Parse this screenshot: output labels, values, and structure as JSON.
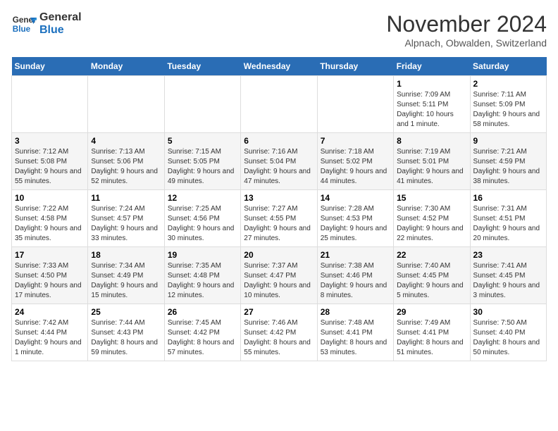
{
  "logo": {
    "line1": "General",
    "line2": "Blue"
  },
  "title": "November 2024",
  "location": "Alpnach, Obwalden, Switzerland",
  "days_header": [
    "Sunday",
    "Monday",
    "Tuesday",
    "Wednesday",
    "Thursday",
    "Friday",
    "Saturday"
  ],
  "weeks": [
    [
      {
        "num": "",
        "info": ""
      },
      {
        "num": "",
        "info": ""
      },
      {
        "num": "",
        "info": ""
      },
      {
        "num": "",
        "info": ""
      },
      {
        "num": "",
        "info": ""
      },
      {
        "num": "1",
        "info": "Sunrise: 7:09 AM\nSunset: 5:11 PM\nDaylight: 10 hours and 1 minute."
      },
      {
        "num": "2",
        "info": "Sunrise: 7:11 AM\nSunset: 5:09 PM\nDaylight: 9 hours and 58 minutes."
      }
    ],
    [
      {
        "num": "3",
        "info": "Sunrise: 7:12 AM\nSunset: 5:08 PM\nDaylight: 9 hours and 55 minutes."
      },
      {
        "num": "4",
        "info": "Sunrise: 7:13 AM\nSunset: 5:06 PM\nDaylight: 9 hours and 52 minutes."
      },
      {
        "num": "5",
        "info": "Sunrise: 7:15 AM\nSunset: 5:05 PM\nDaylight: 9 hours and 49 minutes."
      },
      {
        "num": "6",
        "info": "Sunrise: 7:16 AM\nSunset: 5:04 PM\nDaylight: 9 hours and 47 minutes."
      },
      {
        "num": "7",
        "info": "Sunrise: 7:18 AM\nSunset: 5:02 PM\nDaylight: 9 hours and 44 minutes."
      },
      {
        "num": "8",
        "info": "Sunrise: 7:19 AM\nSunset: 5:01 PM\nDaylight: 9 hours and 41 minutes."
      },
      {
        "num": "9",
        "info": "Sunrise: 7:21 AM\nSunset: 4:59 PM\nDaylight: 9 hours and 38 minutes."
      }
    ],
    [
      {
        "num": "10",
        "info": "Sunrise: 7:22 AM\nSunset: 4:58 PM\nDaylight: 9 hours and 35 minutes."
      },
      {
        "num": "11",
        "info": "Sunrise: 7:24 AM\nSunset: 4:57 PM\nDaylight: 9 hours and 33 minutes."
      },
      {
        "num": "12",
        "info": "Sunrise: 7:25 AM\nSunset: 4:56 PM\nDaylight: 9 hours and 30 minutes."
      },
      {
        "num": "13",
        "info": "Sunrise: 7:27 AM\nSunset: 4:55 PM\nDaylight: 9 hours and 27 minutes."
      },
      {
        "num": "14",
        "info": "Sunrise: 7:28 AM\nSunset: 4:53 PM\nDaylight: 9 hours and 25 minutes."
      },
      {
        "num": "15",
        "info": "Sunrise: 7:30 AM\nSunset: 4:52 PM\nDaylight: 9 hours and 22 minutes."
      },
      {
        "num": "16",
        "info": "Sunrise: 7:31 AM\nSunset: 4:51 PM\nDaylight: 9 hours and 20 minutes."
      }
    ],
    [
      {
        "num": "17",
        "info": "Sunrise: 7:33 AM\nSunset: 4:50 PM\nDaylight: 9 hours and 17 minutes."
      },
      {
        "num": "18",
        "info": "Sunrise: 7:34 AM\nSunset: 4:49 PM\nDaylight: 9 hours and 15 minutes."
      },
      {
        "num": "19",
        "info": "Sunrise: 7:35 AM\nSunset: 4:48 PM\nDaylight: 9 hours and 12 minutes."
      },
      {
        "num": "20",
        "info": "Sunrise: 7:37 AM\nSunset: 4:47 PM\nDaylight: 9 hours and 10 minutes."
      },
      {
        "num": "21",
        "info": "Sunrise: 7:38 AM\nSunset: 4:46 PM\nDaylight: 9 hours and 8 minutes."
      },
      {
        "num": "22",
        "info": "Sunrise: 7:40 AM\nSunset: 4:45 PM\nDaylight: 9 hours and 5 minutes."
      },
      {
        "num": "23",
        "info": "Sunrise: 7:41 AM\nSunset: 4:45 PM\nDaylight: 9 hours and 3 minutes."
      }
    ],
    [
      {
        "num": "24",
        "info": "Sunrise: 7:42 AM\nSunset: 4:44 PM\nDaylight: 9 hours and 1 minute."
      },
      {
        "num": "25",
        "info": "Sunrise: 7:44 AM\nSunset: 4:43 PM\nDaylight: 8 hours and 59 minutes."
      },
      {
        "num": "26",
        "info": "Sunrise: 7:45 AM\nSunset: 4:42 PM\nDaylight: 8 hours and 57 minutes."
      },
      {
        "num": "27",
        "info": "Sunrise: 7:46 AM\nSunset: 4:42 PM\nDaylight: 8 hours and 55 minutes."
      },
      {
        "num": "28",
        "info": "Sunrise: 7:48 AM\nSunset: 4:41 PM\nDaylight: 8 hours and 53 minutes."
      },
      {
        "num": "29",
        "info": "Sunrise: 7:49 AM\nSunset: 4:41 PM\nDaylight: 8 hours and 51 minutes."
      },
      {
        "num": "30",
        "info": "Sunrise: 7:50 AM\nSunset: 4:40 PM\nDaylight: 8 hours and 50 minutes."
      }
    ]
  ]
}
